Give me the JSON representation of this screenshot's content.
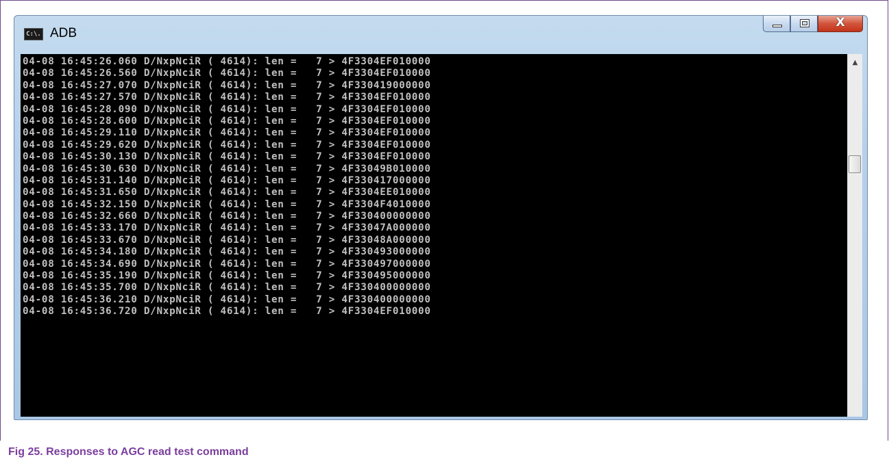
{
  "window": {
    "title": "ADB",
    "icon_label": "C:\\.",
    "close_glyph": "X"
  },
  "console": {
    "lines": [
      "04-08 16:45:26.060 D/NxpNciR ( 4614): len =   7 > 4F3304EF010000",
      "04-08 16:45:26.560 D/NxpNciR ( 4614): len =   7 > 4F3304EF010000",
      "04-08 16:45:27.070 D/NxpNciR ( 4614): len =   7 > 4F330419000000",
      "04-08 16:45:27.570 D/NxpNciR ( 4614): len =   7 > 4F3304EF010000",
      "04-08 16:45:28.090 D/NxpNciR ( 4614): len =   7 > 4F3304EF010000",
      "04-08 16:45:28.600 D/NxpNciR ( 4614): len =   7 > 4F3304EF010000",
      "04-08 16:45:29.110 D/NxpNciR ( 4614): len =   7 > 4F3304EF010000",
      "04-08 16:45:29.620 D/NxpNciR ( 4614): len =   7 > 4F3304EF010000",
      "04-08 16:45:30.130 D/NxpNciR ( 4614): len =   7 > 4F3304EF010000",
      "04-08 16:45:30.630 D/NxpNciR ( 4614): len =   7 > 4F33049B010000",
      "04-08 16:45:31.140 D/NxpNciR ( 4614): len =   7 > 4F330417000000",
      "04-08 16:45:31.650 D/NxpNciR ( 4614): len =   7 > 4F3304EE010000",
      "04-08 16:45:32.150 D/NxpNciR ( 4614): len =   7 > 4F3304F4010000",
      "04-08 16:45:32.660 D/NxpNciR ( 4614): len =   7 > 4F330400000000",
      "04-08 16:45:33.170 D/NxpNciR ( 4614): len =   7 > 4F33047A000000",
      "04-08 16:45:33.670 D/NxpNciR ( 4614): len =   7 > 4F33048A000000",
      "04-08 16:45:34.180 D/NxpNciR ( 4614): len =   7 > 4F330493000000",
      "04-08 16:45:34.690 D/NxpNciR ( 4614): len =   7 > 4F330497000000",
      "04-08 16:45:35.190 D/NxpNciR ( 4614): len =   7 > 4F330495000000",
      "04-08 16:45:35.700 D/NxpNciR ( 4614): len =   7 > 4F330400000000",
      "04-08 16:45:36.210 D/NxpNciR ( 4614): len =   7 > 4F330400000000",
      "04-08 16:45:36.720 D/NxpNciR ( 4614): len =   7 > 4F3304EF010000"
    ]
  },
  "scrollbar": {
    "up_glyph": "▲"
  },
  "caption": "Fig 25. Responses to AGC read test command",
  "colors": {
    "console_bg": "#000000",
    "console_text": "#c0c0c0",
    "caption": "#7a3e9d"
  }
}
